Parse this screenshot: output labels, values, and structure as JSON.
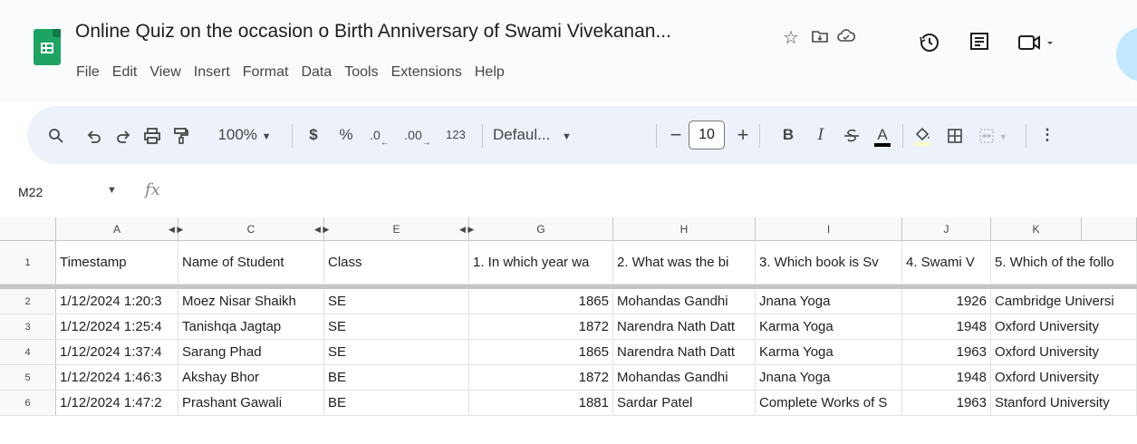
{
  "app": {
    "title": "Online Quiz on the occasion o Birth Anniversary of Swami Vivekanan...",
    "brand_color": "#1ea362"
  },
  "menu": [
    "File",
    "Edit",
    "View",
    "Insert",
    "Format",
    "Data",
    "Tools",
    "Extensions",
    "Help"
  ],
  "title_icons": [
    "star-icon",
    "move-to-folder-icon",
    "cloud-status-icon"
  ],
  "right_icons": [
    "version-history-icon",
    "comments-icon",
    "meet-icon"
  ],
  "toolbar": {
    "zoom": "100%",
    "currency": "$",
    "percent": "%",
    "decrease_decimal": ".0",
    "increase_decimal": ".00",
    "number_format": "123",
    "font": "Defaul...",
    "font_size": "10",
    "minus": "−",
    "plus": "+",
    "bold": "B",
    "italic": "I",
    "text_color": "A"
  },
  "formula_bar": {
    "cell_ref": "M22",
    "fx": "fx"
  },
  "columns": [
    "A",
    "C",
    "E",
    "G",
    "H",
    "I",
    "J",
    "K"
  ],
  "row_numbers": [
    "1",
    "2",
    "3",
    "4",
    "5",
    "6"
  ],
  "header_row": [
    "Timestamp",
    "Name of Student",
    "Class",
    "1. In which year wa",
    "2.  What was the bi",
    "3.  Which book is Sv",
    "4.  Swami V",
    "5.  Which of the follo"
  ],
  "rows": [
    [
      "1/12/2024 1:20:3",
      "Moez Nisar Shaikh",
      "SE",
      "1865",
      "Mohandas Gandhi",
      "Jnana Yoga",
      "1926",
      "Cambridge Universi"
    ],
    [
      "1/12/2024 1:25:4",
      "Tanishqa Jagtap",
      "SE",
      "1872",
      "Narendra Nath Datt",
      "Karma Yoga",
      "1948",
      "Oxford University"
    ],
    [
      "1/12/2024 1:37:4",
      "Sarang Phad",
      "SE",
      "1865",
      "Narendra Nath Datt",
      "Karma Yoga",
      "1963",
      "Oxford University"
    ],
    [
      "1/12/2024 1:46:3",
      "Akshay Bhor",
      "BE",
      "1872",
      "Mohandas Gandhi",
      "Jnana Yoga",
      "1948",
      "Oxford University"
    ],
    [
      "1/12/2024 1:47:2",
      "Prashant Gawali",
      "BE",
      "1881",
      "Sardar Patel",
      "Complete Works of S",
      "1963",
      "Stanford University"
    ]
  ]
}
